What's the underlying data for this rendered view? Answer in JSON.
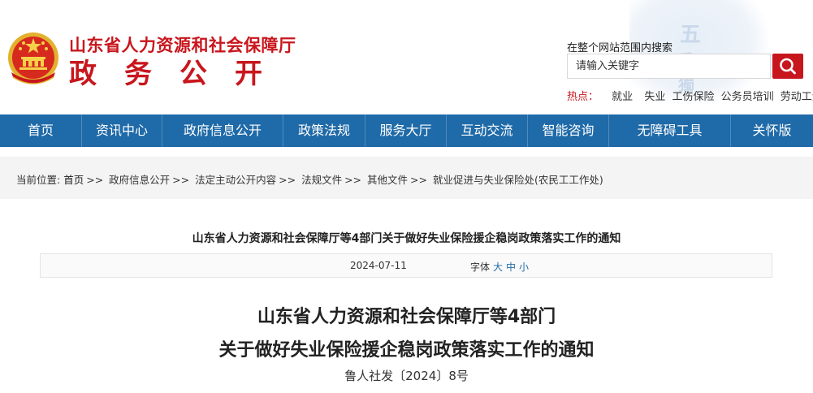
{
  "header": {
    "org_name": "山东省人力资源和社会保障厅",
    "subtitle": "政务公开"
  },
  "search": {
    "label": "在整个网站范围内搜索",
    "placeholder": "请输入关键字"
  },
  "hot": {
    "label": "热点：",
    "items": [
      "就业",
      "失业",
      "工伤保险",
      "公务员培训",
      "劳动工资"
    ]
  },
  "nav": {
    "items": [
      "首页",
      "资讯中心",
      "政府信息公开",
      "政策法规",
      "服务大厅",
      "互动交流",
      "智能咨询",
      "无障碍工具",
      "关怀版"
    ]
  },
  "breadcrumb": {
    "prefix": "当前位置:",
    "home": "首页",
    "separator": ">>",
    "items": [
      "政府信息公开",
      "法定主动公开内容",
      "法规文件",
      "其他文件",
      "就业促进与失业保险处(农民工工作处)"
    ]
  },
  "article": {
    "header_title": "山东省人力资源和社会保障厅等4部门关于做好失业保险援企稳岗政策落实工作的通知",
    "date": "2024-07-11",
    "font_label": "字体",
    "font_sizes": [
      "大",
      "中",
      "小"
    ],
    "title_line1": "山东省人力资源和社会保障厅等4部门",
    "title_line2": "关于做好失业保险援企稳岗政策落实工作的通知",
    "doc_number": "鲁人社发〔2024〕8号"
  },
  "colors": {
    "brand_red": "#c8161d",
    "nav_blue": "#1f6aa8"
  },
  "icons": {
    "emblem": "national-emblem-icon",
    "search": "magnifier-icon"
  }
}
